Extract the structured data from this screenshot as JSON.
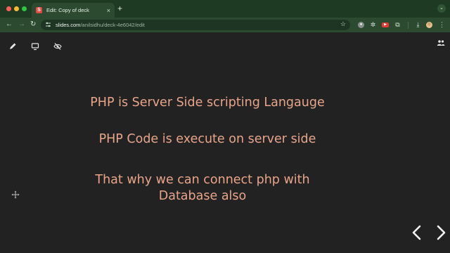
{
  "browser": {
    "tab": {
      "favicon_letter": "S",
      "title": "Edit: Copy of deck",
      "close_glyph": "×"
    },
    "new_tab_glyph": "+",
    "tab_menu_glyph": "⌄",
    "nav": {
      "back": "←",
      "forward": "→",
      "reload": "↻"
    },
    "address": {
      "host": "slides.com",
      "path": "/anilsidhu/deck-4e6042/edit",
      "bookmark_glyph": "☆"
    },
    "extensions": [
      "extension-icon",
      "react-devtools-icon",
      "youtube-icon",
      "extensions-puzzle-icon",
      "download-icon",
      "profile-avatar-icon",
      "menu-kebab-icon"
    ]
  },
  "slide": {
    "lines": [
      "PHP is Server Side scripting Langauge",
      "PHP Code is execute on server side",
      "That why we can connect php with",
      "Database also"
    ]
  },
  "colors": {
    "chrome_tab_bar": "#1e3a23",
    "chrome_toolbar": "#2b4a30",
    "stage_bg": "#222222",
    "slide_text": "#e8a58a"
  }
}
